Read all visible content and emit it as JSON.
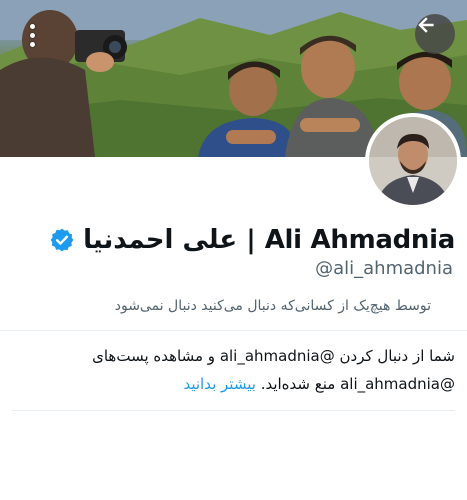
{
  "header": {
    "menu_icon": "more-vertical-icon",
    "back_icon": "arrow-left-icon"
  },
  "profile": {
    "display_name": "علی احمدنیا | Ali Ahmadnia",
    "verified_icon": "verified-badge-icon",
    "handle": "@ali_ahmadnia",
    "follow_note": "توسط هیچ‌یک از کسانی‌که دنبال می‌کنید دنبال نمی‌شود"
  },
  "blocked_notice": {
    "line1": "شما از دنبال کردن @ali_ahmadnia و مشاهده پست‌های",
    "line2_prefix": "@ali_ahmadnia منع شده‌اید.",
    "learn_more": "بیشتر بدانید"
  },
  "colors": {
    "accent": "#1d9bf0",
    "verified": "#1d9bf0",
    "secondary_text": "#536471"
  }
}
